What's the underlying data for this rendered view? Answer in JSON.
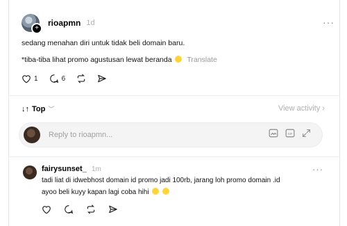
{
  "post": {
    "username": "rioapmn",
    "time": "1d",
    "line1": "sedang menahan diri untuk tidak beli domain baru.",
    "line2": "*tiba-tiba lihat promo agustusan lewat beranda",
    "translate": "Translate",
    "likes": "1",
    "comments": "6",
    "more": "···"
  },
  "sort": {
    "label": "Top"
  },
  "view_activity": "View activity",
  "reply": {
    "placeholder": "Reply to rioapmn..."
  },
  "comment": {
    "username": "fairysunset_",
    "time": "1m",
    "line1": "tadi liat di idwebhost domain id promo jadi 100rb, jarang loh promo domain .id",
    "line2": "ayoo beli kuyy kapan lagi coba hihi",
    "more": "···"
  }
}
